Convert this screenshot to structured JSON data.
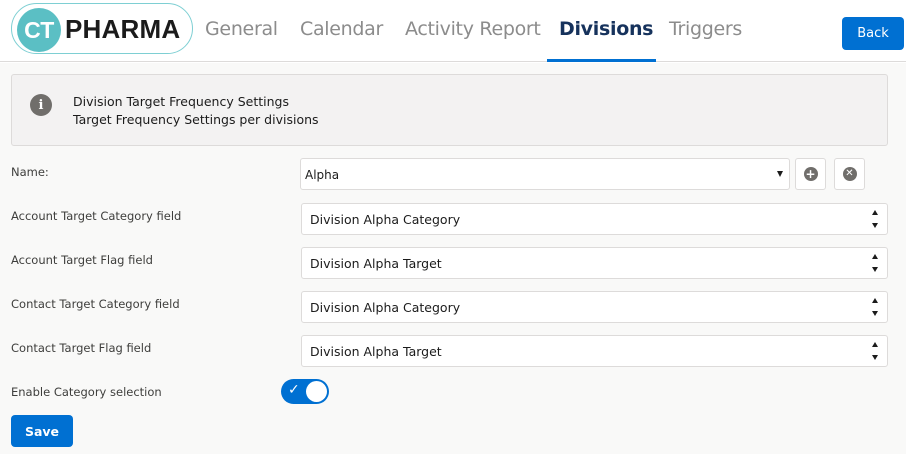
{
  "header": {
    "logo": {
      "badge": "CT",
      "name": "PHARMA"
    },
    "tabs": [
      {
        "label": "General"
      },
      {
        "label": "Calendar"
      },
      {
        "label": "Activity Report"
      },
      {
        "label": "Divisions",
        "active": true
      },
      {
        "label": "Triggers"
      }
    ],
    "back_label": "Back"
  },
  "info": {
    "icon": "info-icon",
    "title": "Division Target Frequency Settings",
    "subtitle": "Target Frequency Settings per divisions"
  },
  "form": {
    "name": {
      "label": "Name:",
      "value": "Alpha",
      "add_icon": "add-icon",
      "remove_icon": "remove-icon"
    },
    "account_category": {
      "label": "Account Target Category field",
      "value": "Division Alpha Category"
    },
    "account_flag": {
      "label": "Account Target Flag field",
      "value": "Division Alpha Target"
    },
    "contact_category": {
      "label": "Contact Target Category field",
      "value": "Division Alpha Category"
    },
    "contact_flag": {
      "label": "Contact Target Flag field",
      "value": "Division Alpha Target"
    },
    "enable_category": {
      "label": "Enable Category selection",
      "checked": true
    },
    "save_label": "Save"
  },
  "colors": {
    "accent": "#0070d2",
    "logo_teal": "#5bbfc4",
    "active_tab": "#16325c",
    "inactive_tab": "#8c8c8c"
  }
}
